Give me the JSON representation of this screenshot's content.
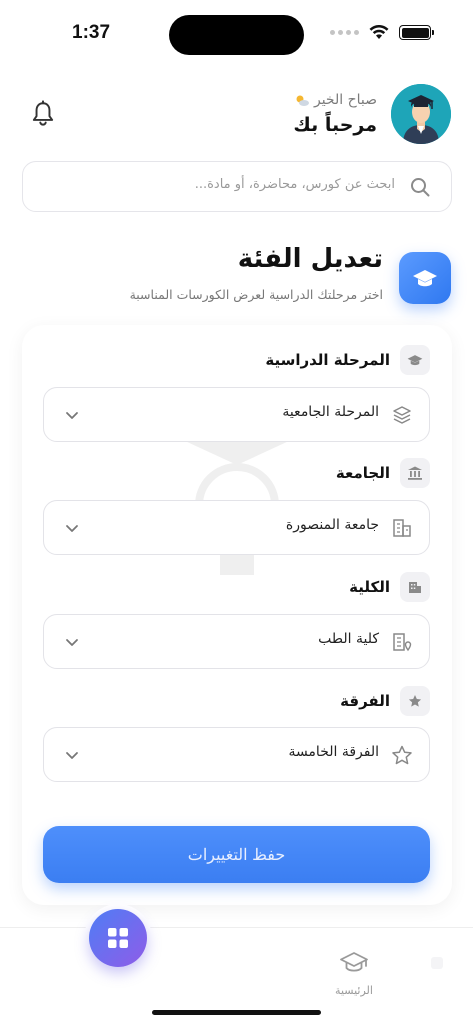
{
  "status_bar": {
    "time": "1:37"
  },
  "header": {
    "greeting": "صباح الخير",
    "greeting_icon": "sun-cloud-icon",
    "welcome": "مرحباً بك"
  },
  "search": {
    "placeholder": "ابحث عن كورس، محاضرة، أو مادة..."
  },
  "section": {
    "title": "تعديل الفئة",
    "subtitle": "اختر مرحلتك الدراسية لعرض الكورسات المناسبة"
  },
  "fields": [
    {
      "label": "المرحلة الدراسية",
      "value": "المرحلة الجامعية",
      "label_icon": "graduation-cap-icon",
      "value_icon": "layers-icon"
    },
    {
      "label": "الجامعة",
      "value": "جامعة المنصورة",
      "label_icon": "institution-icon",
      "value_icon": "building-icon"
    },
    {
      "label": "الكلية",
      "value": "كلية الطب",
      "label_icon": "office-building-icon",
      "value_icon": "building-pin-icon"
    },
    {
      "label": "الفرقة",
      "value": "الفرقة الخامسة",
      "label_icon": "star-icon",
      "value_icon": "star-outline-icon"
    }
  ],
  "save_button": {
    "label": "حفظ التغييرات"
  },
  "bottom_nav": {
    "home_label": "الرئيسية"
  },
  "colors": {
    "accent": "#3b82f6",
    "fab_start": "#4f7df5",
    "fab_end": "#8f5ce8"
  }
}
